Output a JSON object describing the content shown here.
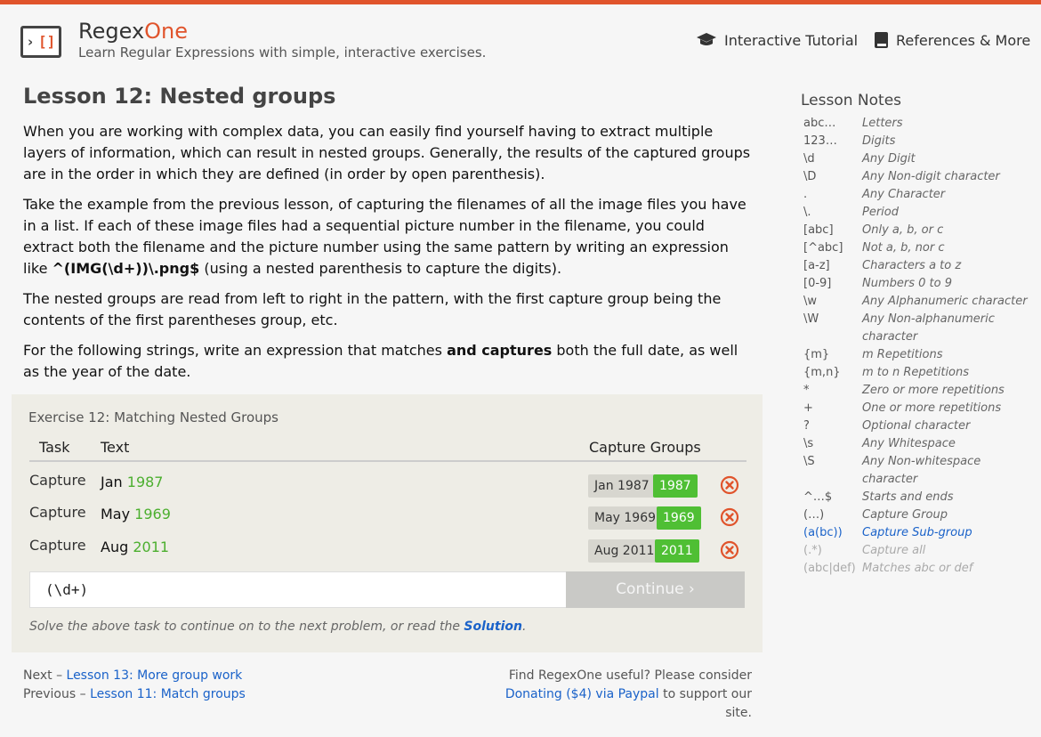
{
  "brand": {
    "name_a": "Regex",
    "name_b": "One",
    "tagline": "Learn Regular Expressions with simple, interactive exercises."
  },
  "nav": {
    "tutorial": "Interactive Tutorial",
    "references": "References & More"
  },
  "lesson": {
    "title": "Lesson 12: Nested groups",
    "p1": "When you are working with complex data, you can easily find yourself having to extract multiple layers of information, which can result in nested groups. Generally, the results of the captured groups are in the order in which they are defined (in order by open parenthesis).",
    "p2a": "Take the example from the previous lesson, of capturing the filenames of all the image files you have in a list. If each of these image files had a sequential picture number in the filename, you could extract both the filename and the picture number using the same pattern by writing an expression like ",
    "p2code": "^(IMG(\\d+))\\.png$",
    "p2b": " (using a nested parenthesis to capture the digits).",
    "p3": "The nested groups are read from left to right in the pattern, with the first capture group being the contents of the first parentheses group, etc.",
    "p4a": "For the following strings, write an expression that matches ",
    "p4b": "and captures",
    "p4c": " both the full date, as well as the year of the date."
  },
  "exercise": {
    "title": "Exercise 12: Matching Nested Groups",
    "headers": {
      "task": "Task",
      "text": "Text",
      "groups": "Capture Groups"
    },
    "rows": [
      {
        "task": "Capture",
        "month": "Jan",
        "year": "1987",
        "full": "Jan 1987",
        "group": "1987"
      },
      {
        "task": "Capture",
        "month": "May",
        "year": "1969",
        "full": "May 1969",
        "group": "1969"
      },
      {
        "task": "Capture",
        "month": "Aug",
        "year": "2011",
        "full": "Aug 2011",
        "group": "2011"
      }
    ],
    "input_value": "(\\d+)",
    "continue_label": "Continue ›",
    "hint_a": "Solve the above task to continue on to the next problem, or read the ",
    "hint_link": "Solution",
    "hint_b": "."
  },
  "footer": {
    "next_label": "Next – ",
    "next_link": "Lesson 13: More group work",
    "prev_label": "Previous – ",
    "prev_link": "Lesson 11: Match groups",
    "donate_a": "Find RegexOne useful? Please consider",
    "donate_link": "Donating ($4) via Paypal",
    "donate_b": " to support our site."
  },
  "notes": {
    "title": "Lesson Notes",
    "items": [
      {
        "k": "abc…",
        "v": "Letters"
      },
      {
        "k": "123…",
        "v": "Digits"
      },
      {
        "k": "\\d",
        "v": "Any Digit"
      },
      {
        "k": "\\D",
        "v": "Any Non-digit character"
      },
      {
        "k": ".",
        "v": "Any Character"
      },
      {
        "k": "\\.",
        "v": "Period"
      },
      {
        "k": "[abc]",
        "v": "Only a, b, or c"
      },
      {
        "k": "[^abc]",
        "v": "Not a, b, nor c"
      },
      {
        "k": "[a-z]",
        "v": "Characters a to z"
      },
      {
        "k": "[0-9]",
        "v": "Numbers 0 to 9"
      },
      {
        "k": "\\w",
        "v": "Any Alphanumeric character"
      },
      {
        "k": "\\W",
        "v": "Any Non-alphanumeric character"
      },
      {
        "k": "{m}",
        "v": "m Repetitions"
      },
      {
        "k": "{m,n}",
        "v": "m to n Repetitions"
      },
      {
        "k": "*",
        "v": "Zero or more repetitions"
      },
      {
        "k": "+",
        "v": "One or more repetitions"
      },
      {
        "k": "?",
        "v": "Optional character"
      },
      {
        "k": "\\s",
        "v": "Any Whitespace"
      },
      {
        "k": "\\S",
        "v": "Any Non-whitespace character"
      },
      {
        "k": "^…$",
        "v": "Starts and ends"
      },
      {
        "k": "(…)",
        "v": "Capture Group"
      },
      {
        "k": "(a(bc))",
        "v": "Capture Sub-group"
      },
      {
        "k": "(.*)",
        "v": "Capture all"
      },
      {
        "k": "(abc|def)",
        "v": "Matches abc or def"
      }
    ]
  },
  "colors": {
    "accent": "#e0542c",
    "link": "#1a62c9",
    "success": "#4fbf34",
    "error": "#e0542c"
  },
  "icons": {
    "tutorial": "graduation-cap-icon",
    "references": "book-icon",
    "row_status": "error-circle-x-icon"
  }
}
